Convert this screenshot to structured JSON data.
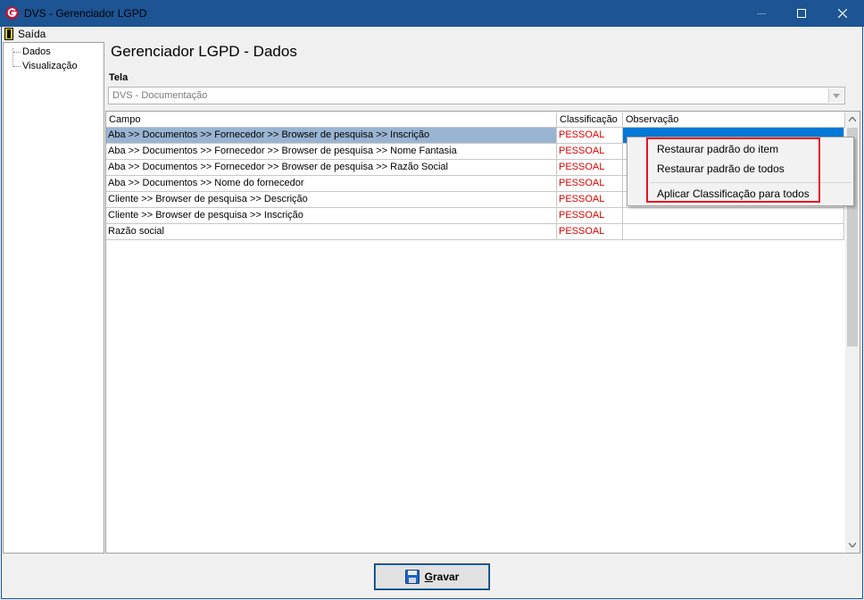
{
  "window": {
    "title": "DVS - Gerenciador LGPD"
  },
  "menu": {
    "exit_label": "Saída"
  },
  "tree": {
    "items": [
      "Dados",
      "Visualização"
    ]
  },
  "page": {
    "title": "Gerenciador LGPD - Dados",
    "tela_label": "Tela",
    "tela_value": "DVS - Documentação"
  },
  "grid": {
    "columns": [
      "Campo",
      "Classificação",
      "Observação"
    ],
    "rows": [
      {
        "campo": "Aba >> Documentos  >> Fornecedor >> Browser de pesquisa >> Inscrição",
        "classificacao": "PESSOAL",
        "observacao": ""
      },
      {
        "campo": "Aba >> Documentos  >> Fornecedor >> Browser de pesquisa >> Nome Fantasia",
        "classificacao": "PESSOAL",
        "observacao": ""
      },
      {
        "campo": "Aba >> Documentos  >> Fornecedor >> Browser de pesquisa >> Razão Social",
        "classificacao": "PESSOAL",
        "observacao": ""
      },
      {
        "campo": "Aba >> Documentos  >> Nome do fornecedor",
        "classificacao": "PESSOAL",
        "observacao": ""
      },
      {
        "campo": "Cliente >> Browser de pesquisa >> Descrição",
        "classificacao": "PESSOAL",
        "observacao": ""
      },
      {
        "campo": "Cliente >> Browser de pesquisa >> Inscrição",
        "classificacao": "PESSOAL",
        "observacao": ""
      },
      {
        "campo": "Razão social",
        "classificacao": "PESSOAL",
        "observacao": ""
      }
    ]
  },
  "context_menu": {
    "items": [
      "Restaurar padrão do item",
      "Restaurar padrão de todos",
      "Aplicar Classificação para todos"
    ]
  },
  "buttons": {
    "gravar_prefix": "G",
    "gravar_rest": "ravar"
  },
  "colors": {
    "titlebar": "#1c5494",
    "classification_text": "#e00000",
    "selected_row": "#99b4d1",
    "highlight_border": "#e81123"
  }
}
